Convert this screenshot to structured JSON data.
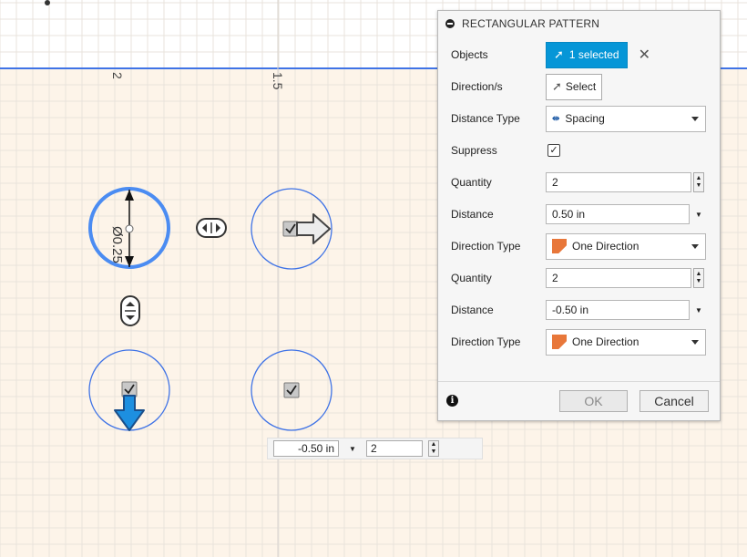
{
  "canvas": {
    "background": "#fdf4e9",
    "grid_color": "#e9e3dc",
    "sketch_blue": "#3f73e6",
    "dimensions": {
      "left_label": "2",
      "top_label": "1.5",
      "diameter_label": "Ø0.25"
    }
  },
  "manipulator": {
    "distance_value": "-0.50 in",
    "quantity_value": "2"
  },
  "dialog": {
    "title": "RECTANGULAR PATTERN",
    "objects": {
      "label": "Objects",
      "button": "1 selected"
    },
    "directions": {
      "label": "Direction/s",
      "button": "Select"
    },
    "distance_type": {
      "label": "Distance Type",
      "value": "Spacing"
    },
    "suppress": {
      "label": "Suppress",
      "checked": true
    },
    "direction1": {
      "quantity_label": "Quantity",
      "quantity": "2",
      "distance_label": "Distance",
      "distance": "0.50 in",
      "direction_type_label": "Direction Type",
      "direction_type": "One Direction"
    },
    "direction2": {
      "quantity_label": "Quantity",
      "quantity": "2",
      "distance_label": "Distance",
      "distance": "-0.50 in",
      "direction_type_label": "Direction Type",
      "direction_type": "One Direction"
    },
    "ok_label": "OK",
    "cancel_label": "Cancel",
    "accent": "#0696d7"
  }
}
